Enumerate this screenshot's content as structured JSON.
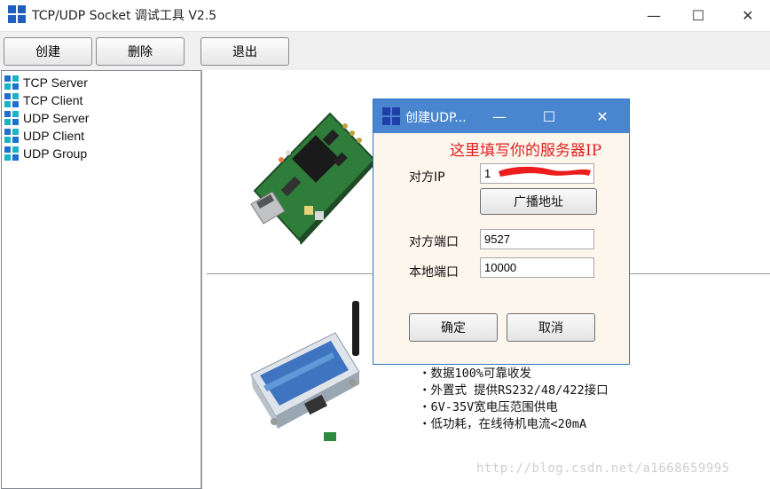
{
  "window": {
    "title": "TCP/UDP Socket 调试工具 V2.5",
    "min_glyph": "—",
    "max_glyph": "☐",
    "close_glyph": "✕"
  },
  "toolbar": {
    "create": "创建",
    "delete": "删除",
    "exit": "退出"
  },
  "tree": {
    "items": [
      "TCP Server",
      "TCP Client",
      "UDP Server",
      "UDP Client",
      "UDP Group"
    ]
  },
  "features": [
    "・数据100%可靠收发",
    "・外置式 提供RS232/48/422接口",
    "・6V-35V宽电压范围供电",
    "・低功耗，在线待机电流<20mA"
  ],
  "watermark": "http://blog.csdn.net/a1668659995",
  "dialog": {
    "title": "创建UDP...",
    "hint": "这里填写你的服务器IP",
    "remote_ip_label": "对方IP",
    "remote_ip_value": "1",
    "broadcast_button": "广播地址",
    "remote_port_label": "对方端口",
    "remote_port_value": "9527",
    "local_port_label": "本地端口",
    "local_port_value": "10000",
    "ok_button": "确定",
    "cancel_button": "取消"
  },
  "colors": {
    "dialog_title_bg": "#4a86cf",
    "hint_text": "#e02020",
    "redaction": "#ee1c1c"
  }
}
